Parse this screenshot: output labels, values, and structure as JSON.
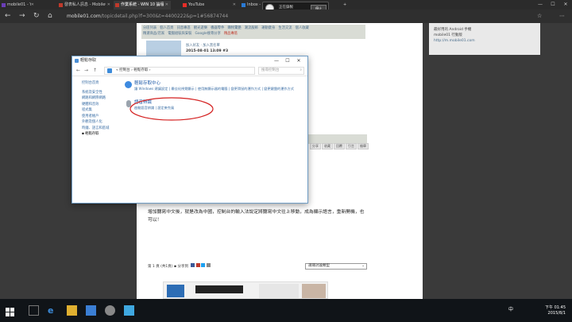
{
  "browser": {
    "tabs": [
      {
        "label": "mobile01 - Yahoo奇摩 搜尋結果",
        "fav": "#6a3db8"
      },
      {
        "label": "發表私人訊息 - Mobile01",
        "fav": "#c0392b"
      },
      {
        "label": "作業系統 - WIN 10 論壇",
        "fav": "#c0392b"
      },
      {
        "label": "YouTube",
        "fav": "#e52d27"
      },
      {
        "label": "Inbox - ...",
        "fav": "#2a7ad4"
      }
    ],
    "url_host": "mobile01.com",
    "url_path": "/topicdetail.php?f=300&t=4400222&p=1#56874744",
    "icons": [
      "back-icon",
      "forward-icon",
      "refresh-icon",
      "home-icon",
      "menu-icon"
    ]
  },
  "popup": {
    "label": "正在錄製",
    "button": "停止"
  },
  "site": {
    "nav_links": [
      "分區列表",
      "個人首頁",
      "訊息專區",
      "觀光遊樂",
      "機器零件",
      "購物驚艷",
      "潮流服飾",
      "運動健身",
      "生活交流",
      "個人收藏"
    ],
    "nav_links2": [
      "精選商品/店家",
      "電腦組裝與安裝",
      "Google搜尋分享",
      "精品專區"
    ],
    "user_line1": "加入好友 · 加入黑名單",
    "post_time": "2015-08-01 13:09 #3",
    "sidebox_lines": [
      "最好用的 Android 手機",
      "mobile01 行動版",
      "http://m.mobile01.com"
    ],
    "article_text": "增加聽寫中文後，就是改為中國，控制台的輸入法說定將聽寫中文往上移動，成為顯示語言，重新開機，也可以！",
    "pager": "第 1 頁 (共1頁) ▪ 分享到",
    "sort_label": "選擇討論類型",
    "side_tags": [
      "分享",
      "收藏",
      "回覆",
      "引言",
      "檢舉"
    ]
  },
  "control_panel": {
    "title": "輕鬆存取",
    "controls": [
      "—",
      "☐",
      "✕"
    ],
    "breadcrumb": "« 控制台  ›  輕鬆存取  ›",
    "search_placeholder": "搜尋控制台",
    "left_nav": [
      "控制台首頁",
      "系統及安全性",
      "網路和網際網路",
      "硬體和音效",
      "程式集",
      "使用者帳戶",
      "外觀及個人化",
      "時鐘、語言和區域",
      "輕鬆存取"
    ],
    "sections": [
      {
        "heading": "輕鬆存取中心",
        "links": "讓 Windows 建議設定 | 最佳化視覺顯示 | 使用無顯示器的電腦 | 變更滑鼠的運作方式 | 變更鍵盤的運作方式"
      },
      {
        "heading": "語音辨識",
        "links": "啟動語音辨識 | 設定麥克風"
      }
    ]
  },
  "taskbar": {
    "time": "下午 01:45",
    "date": "2015/8/1",
    "lang": "中"
  }
}
